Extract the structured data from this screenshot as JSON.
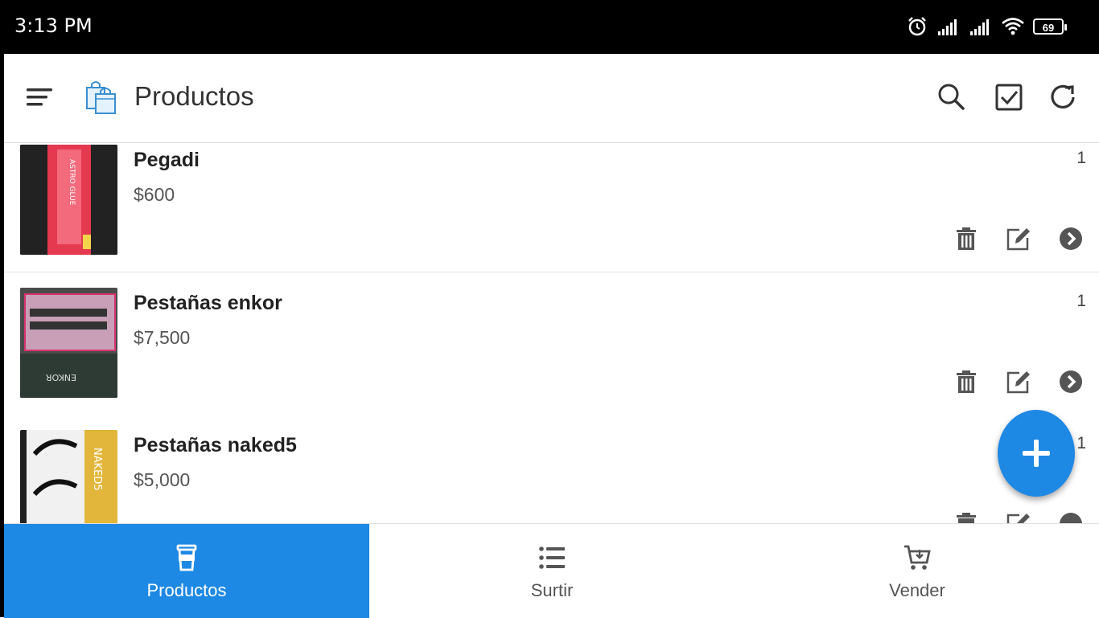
{
  "status_bar": {
    "time": "3:13 PM",
    "battery": "69",
    "icons": [
      "alarm-icon",
      "signal-icon",
      "signal-icon",
      "wifi-icon",
      "battery-icon"
    ]
  },
  "app_bar": {
    "title": "Productos",
    "icons": [
      "menu-icon",
      "shopping-bags-icon",
      "search-icon",
      "checkbox-icon",
      "refresh-icon"
    ]
  },
  "products": [
    {
      "name": "Pegadi",
      "price": "$600",
      "quantity": "1",
      "thumb_label": "ASTRO GLUE"
    },
    {
      "name": "Pestañas enkor",
      "price": "$7,500",
      "quantity": "1",
      "thumb_label": "ENKOR"
    },
    {
      "name": "Pestañas naked5",
      "price": "$5,000",
      "quantity": "1",
      "thumb_label": "NAKED5"
    }
  ],
  "row_actions": [
    "delete-icon",
    "edit-icon",
    "chevron-right-icon"
  ],
  "fab": {
    "icon": "plus-icon"
  },
  "bottom_nav": {
    "tabs": [
      {
        "label": "Productos",
        "icon": "cup-icon",
        "active": true
      },
      {
        "label": "Surtir",
        "icon": "list-icon",
        "active": false
      },
      {
        "label": "Vender",
        "icon": "cart-icon",
        "active": false
      }
    ]
  },
  "colors": {
    "accent": "#1e88e5",
    "status_bar": "#000000",
    "text": "#333333"
  }
}
